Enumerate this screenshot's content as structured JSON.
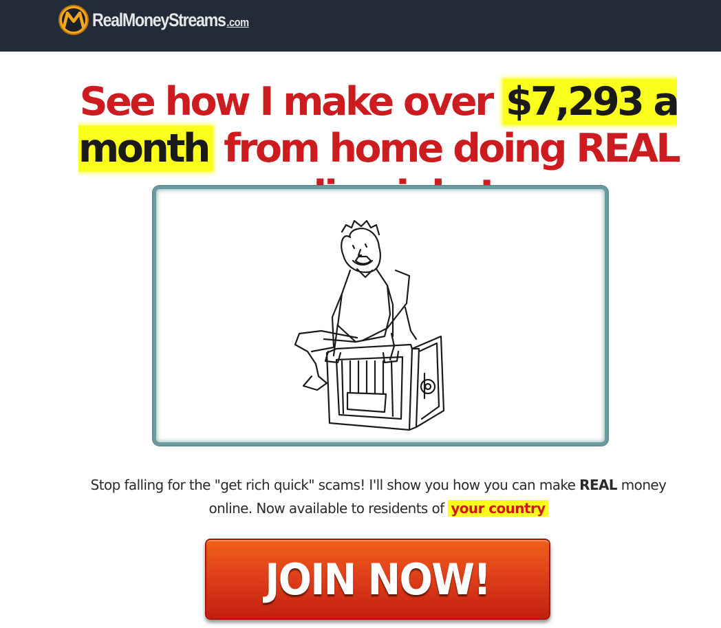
{
  "header": {
    "brand_name": "RealMoneyStreams",
    "brand_tld": ".com",
    "logo_icon": "m-coin-logo-icon",
    "colors": {
      "bar": "#232a38",
      "logo_gold": "#f5a81c"
    }
  },
  "headline": {
    "part1": "See how I make over ",
    "highlight": "$7,293 a month",
    "part2": " from home doing REAL online jobs!",
    "color": "#cc1c1f",
    "highlight_color": "#fbff1e"
  },
  "video": {
    "illustration_icon": "man-sitting-on-open-safe-sketch"
  },
  "subtext": {
    "part1": "Stop falling for the \"get rich quick\" scams! I'll show you how you can make ",
    "emphasis": "REAL",
    "part2": " money online. Now available to residents of",
    "country": "your country"
  },
  "cta": {
    "label": "JOIN NOW!",
    "color": "#e0401a"
  }
}
